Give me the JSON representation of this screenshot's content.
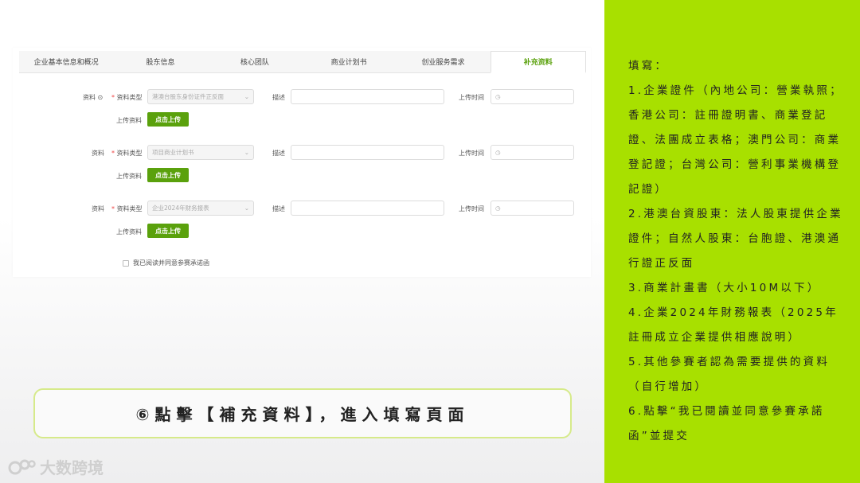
{
  "tabs": [
    {
      "label": "企业基本信息和概况"
    },
    {
      "label": "股东信息"
    },
    {
      "label": "核心团队"
    },
    {
      "label": "商业计划书"
    },
    {
      "label": "创业服务需求"
    },
    {
      "label": "补充资料",
      "active": true
    }
  ],
  "form": {
    "rows": [
      {
        "material_label": "资料 ⊙",
        "type_label": "资料类型",
        "type_value": "港澳台股东身份证件正反面",
        "desc_label": "描述",
        "time_label": "上传时间",
        "upload_label": "上传资料",
        "upload_button": "点击上传"
      },
      {
        "material_label": "资料",
        "type_label": "资料类型",
        "type_value": "项目商业计划书",
        "desc_label": "描述",
        "time_label": "上传时间",
        "upload_label": "上传资料",
        "upload_button": "点击上传"
      },
      {
        "material_label": "资料",
        "type_label": "资料类型",
        "type_value": "企业2024年财务报表",
        "desc_label": "描述",
        "time_label": "上传时间",
        "upload_label": "上传资料",
        "upload_button": "点击上传"
      }
    ],
    "agree_text": "我已阅读并同意参赛承诺函"
  },
  "callout": {
    "text": "⑥點擊【補充資料】，進入填寫頁面"
  },
  "logo": {
    "text": "大数跨境"
  },
  "panel": {
    "lines": [
      "填寫：",
      "1.企業證件（內地公司：營業執照；香港公司：註冊證明書、商業登記證、法團成立表格；澳門公司：商業登記證；台灣公司：營利事業機構登記證）",
      "2.港澳台資股東：法人股東提供企業證件；自然人股東：台胞證、港澳通行證正反面",
      "3.商業計畫書（大小10M以下）",
      "4.企業2024年財務報表（2025年註冊成立企業提供相應說明）",
      "5.其他參賽者認為需要提供的資料（自行增加）",
      "6.點擊“我已閱讀並同意參賽承諾函”並提交"
    ]
  },
  "colors": {
    "accent_green": "#5aa10c",
    "panel_green": "#a8e000",
    "callout_border": "#d6ea8a"
  }
}
